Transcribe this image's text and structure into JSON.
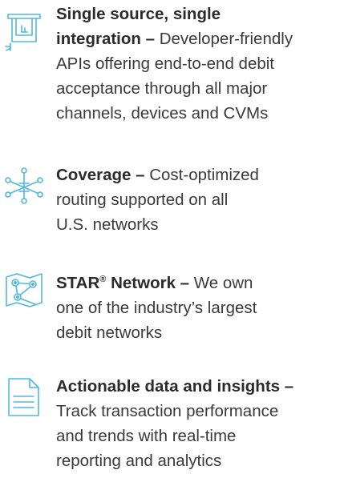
{
  "accent_color": "#4fb8e0",
  "text_color": "#3a3a3a",
  "features": [
    {
      "icon": "card-terminal-icon",
      "lines": [
        {
          "title": "Single source, single",
          "desc": ""
        },
        {
          "title": "integration –",
          "desc": " Developer-friendly"
        },
        {
          "title": "",
          "desc": "APIs offering end-to-end debit"
        },
        {
          "title": "",
          "desc": "acceptance through all major"
        },
        {
          "title": "",
          "desc": "channels, devices and CVMs"
        }
      ]
    },
    {
      "icon": "network-routing-icon",
      "lines": [
        {
          "title": "Coverage –",
          "desc": " Cost-optimized"
        },
        {
          "title": "",
          "desc": "routing supported on all"
        },
        {
          "title": "",
          "desc": "U.S. networks"
        }
      ]
    },
    {
      "icon": "network-map-icon",
      "title_prefix": "STAR",
      "title_mark": "®",
      "lines": [
        {
          "title": " Network –",
          "desc": " We own"
        },
        {
          "title": "",
          "desc": "one of the industry’s largest"
        },
        {
          "title": "",
          "desc": "debit networks"
        }
      ]
    },
    {
      "icon": "document-icon",
      "lines": [
        {
          "title": "Actionable data and insights –",
          "desc": ""
        },
        {
          "title": "",
          "desc": "Track transaction performance"
        },
        {
          "title": "",
          "desc": "and trends with real-time"
        },
        {
          "title": "",
          "desc": "reporting and analytics"
        }
      ]
    }
  ]
}
